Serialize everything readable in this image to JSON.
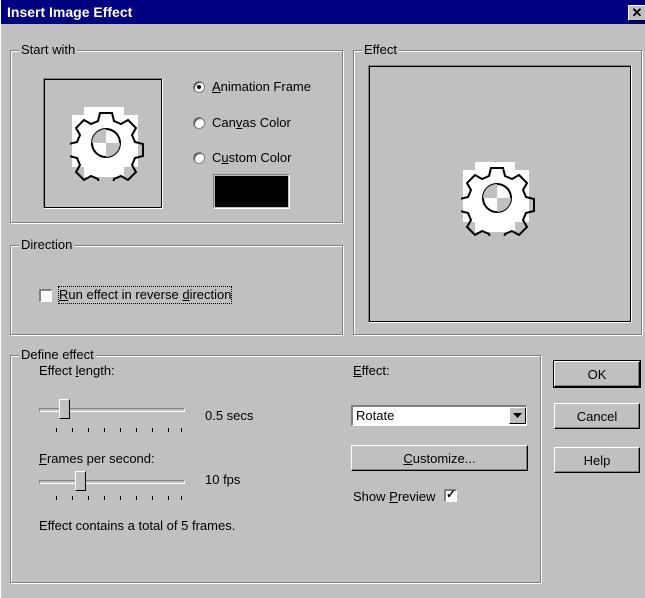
{
  "window": {
    "title": "Insert Image Effect",
    "close_glyph": "✕"
  },
  "start_with": {
    "group_label": "Start with",
    "preview_icon": "gear-icon",
    "options": [
      {
        "label": "Animation Frame",
        "accel": "A",
        "rest": "nimation Frame",
        "selected": true
      },
      {
        "label": "Canvas Color",
        "pre": "Can",
        "accel": "v",
        "rest": "as Color",
        "selected": false
      },
      {
        "label": "Custom Color",
        "pre": "C",
        "accel": "u",
        "rest": "stom Color",
        "selected": false
      }
    ],
    "custom_color": "#000000"
  },
  "direction": {
    "group_label": "Direction",
    "reverse": {
      "pre": "",
      "accel": "R",
      "rest": "un effect in reverse ",
      "accel2": "d",
      "rest2": "irection",
      "checked": false
    }
  },
  "effect_preview": {
    "group_label": "Effect",
    "preview_icon": "gear-icon"
  },
  "define_effect": {
    "group_label": "Define effect",
    "length": {
      "pre": "Effect ",
      "accel": "l",
      "rest": "ength:",
      "value": "0.5 secs"
    },
    "fps": {
      "pre": "",
      "accel": "F",
      "rest": "rames per second:",
      "value": "10 fps"
    },
    "summary": "Effect contains a total of 5 frames.",
    "effect_label": {
      "pre": "",
      "accel": "E",
      "rest": "ffect:"
    },
    "effect_value": "Rotate",
    "customize": {
      "pre": "",
      "accel": "C",
      "rest": "ustomize..."
    },
    "show_preview": {
      "pre": "Show ",
      "accel": "P",
      "rest": "review",
      "checked": true
    }
  },
  "buttons": {
    "ok": "OK",
    "cancel": "Cancel",
    "help": "Help"
  }
}
